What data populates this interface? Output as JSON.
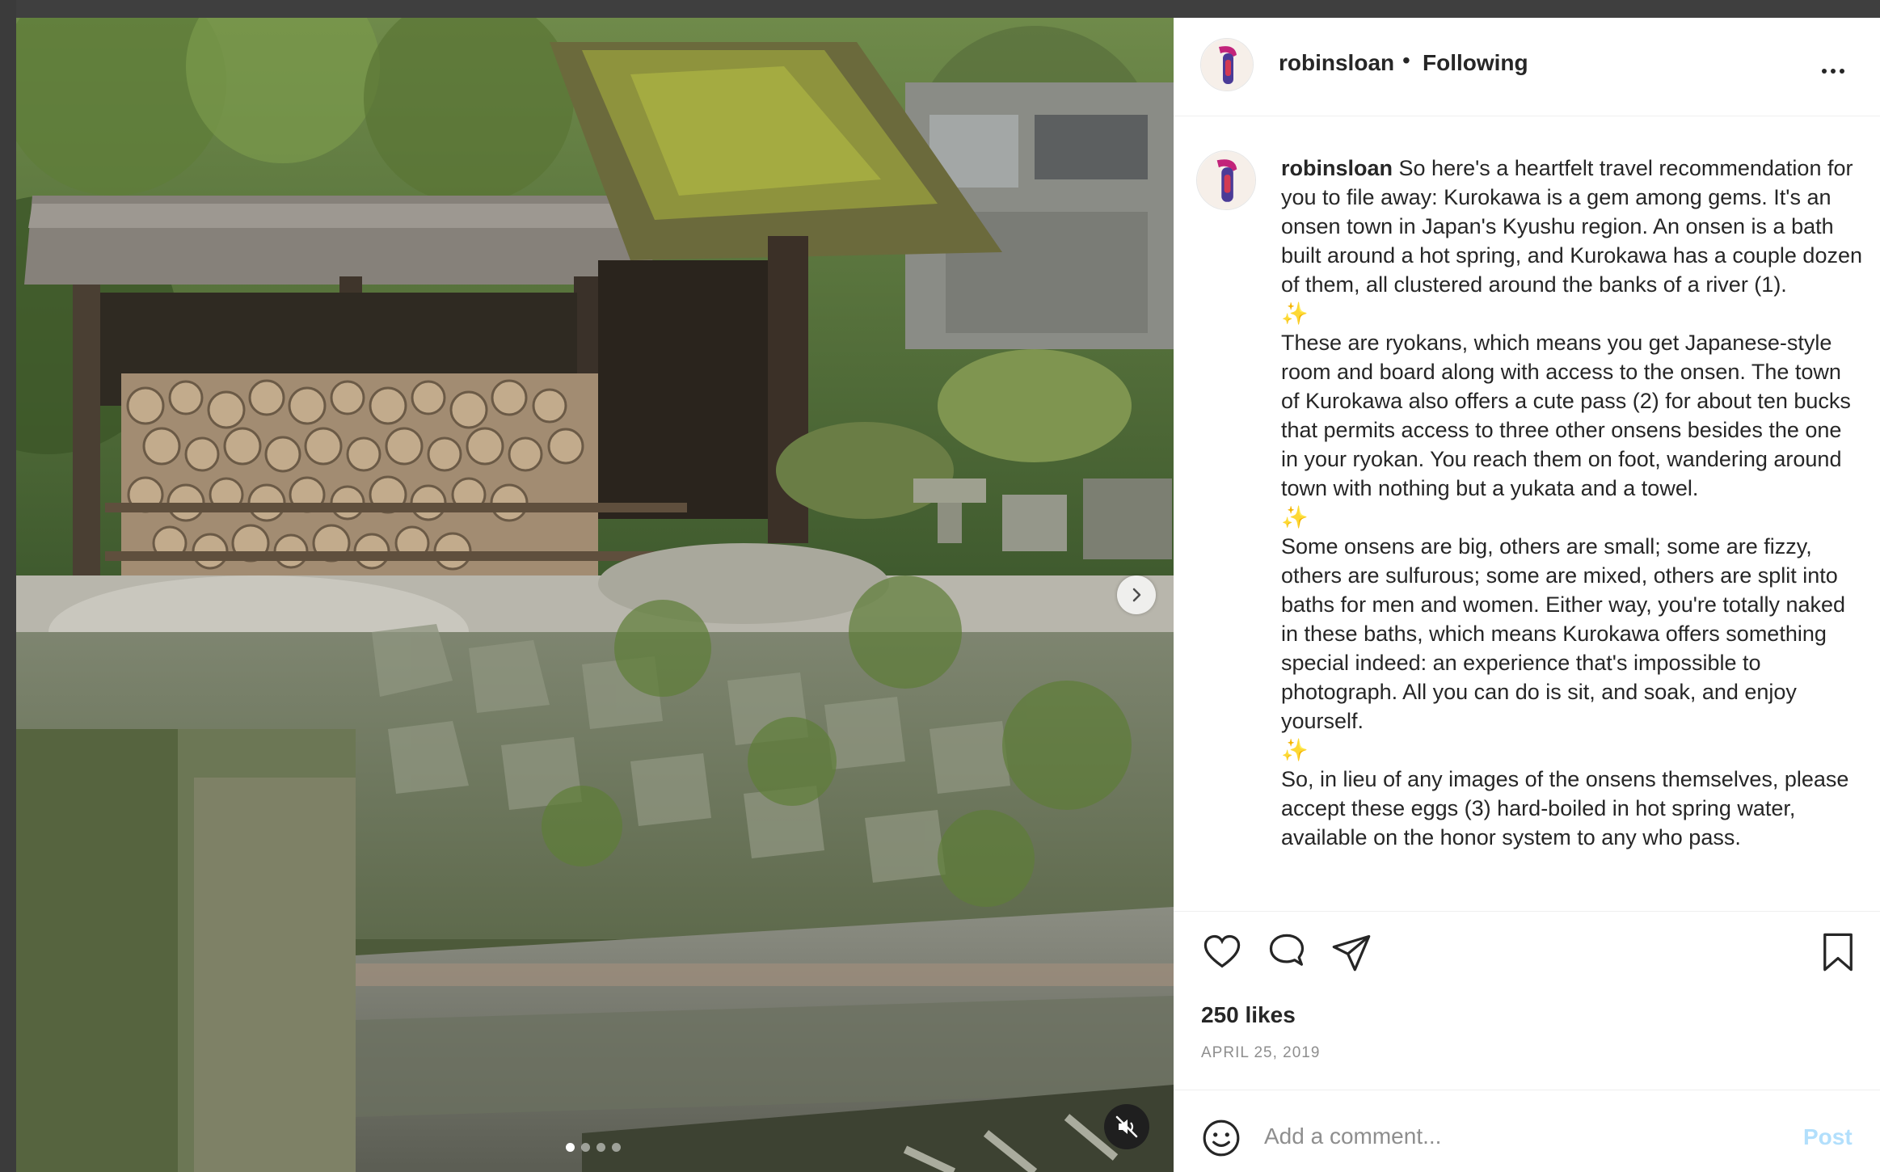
{
  "post": {
    "username": "robinsloan",
    "separator": "•",
    "follow_status": "Following",
    "caption": {
      "username": "robinsloan",
      "paragraphs": [
        "So here's a heartfelt travel recommendation for you to file away: Kurokawa is a gem among gems. It's an onsen town in Japan's Kyushu region. An onsen is a bath built around a hot spring, and Kurokawa has a couple dozen of them, all clustered around the banks of a river (1).",
        "These are ryokans, which means you get Japanese-style room and board along with access to the onsen. The town of Kurokawa also offers a cute pass (2) for about ten bucks that permits access to three other onsens besides the one in your ryokan. You reach them on foot, wandering around town with nothing but a yukata and a towel.",
        "Some onsens are big, others are small; some are fizzy, others are sulfurous; some are mixed, others are split into baths for men and women. Either way, you're totally naked in these baths, which means Kurokawa offers something special indeed: an experience that's impossible to photograph. All you can do is sit, and soak, and enjoy yourself.",
        "So, in lieu of any images of the onsens themselves, please accept these eggs (3) hard-boiled in hot spring water, available on the honor system to any who pass."
      ],
      "separator_glyph": "✨"
    },
    "likes": "250 likes",
    "date": "APRIL 25, 2019"
  },
  "comment": {
    "placeholder": "Add a comment...",
    "post_label": "Post"
  },
  "media": {
    "slide_count": 4,
    "active_slide": 1
  },
  "icons": {
    "like": "heart-icon",
    "comment": "comment-bubble-icon",
    "share": "paper-plane-icon",
    "save": "bookmark-icon",
    "more": "more-horizontal-icon",
    "mute": "speaker-muted-icon",
    "next": "chevron-right-icon",
    "emoji": "smiley-icon"
  }
}
